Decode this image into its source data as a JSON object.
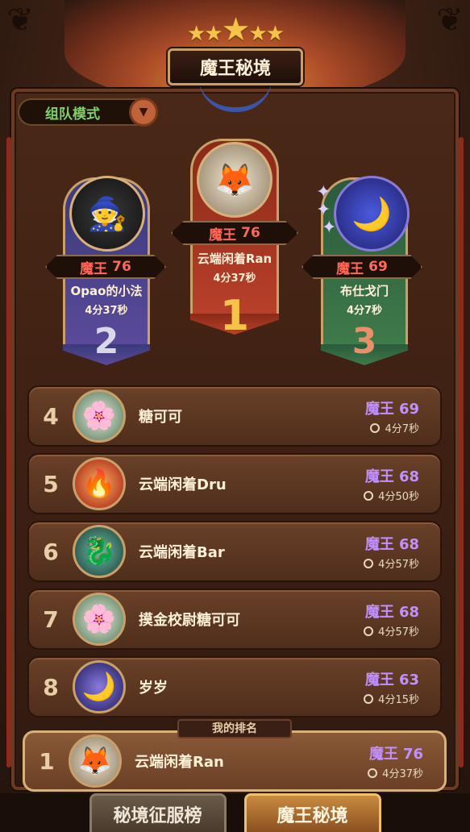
{
  "header": {
    "title": "魔王秘境",
    "stars": 5
  },
  "mode_selector": {
    "label": "组队模式"
  },
  "podium": [
    {
      "rank": "2",
      "level_label": "魔王",
      "level": "76",
      "name": "Opao的小法",
      "time": "4分37秒",
      "color": "#5a4a9a",
      "avatar_icon": "witch-hat-icon"
    },
    {
      "rank": "1",
      "level_label": "魔王",
      "level": "76",
      "name": "云端闲着Ran",
      "time": "4分37秒",
      "color": "#b8402a",
      "avatar_icon": "fox-hood-icon"
    },
    {
      "rank": "3",
      "level_label": "魔王",
      "level": "69",
      "name": "布仕戈门",
      "time": "4分7秒",
      "color": "#3f7a4a",
      "avatar_icon": "moon-orb-icon"
    }
  ],
  "list": [
    {
      "rank": "4",
      "name": "糖可可",
      "level_label": "魔王",
      "level": "69",
      "time": "4分7秒",
      "icon": "flower-spirit-icon"
    },
    {
      "rank": "5",
      "name": "云端闲着Dru",
      "level_label": "魔王",
      "level": "68",
      "time": "4分50秒",
      "icon": "fire-spiral-icon"
    },
    {
      "rank": "6",
      "name": "云端闲着Bar",
      "level_label": "魔王",
      "level": "68",
      "time": "4分57秒",
      "icon": "dragon-icon"
    },
    {
      "rank": "7",
      "name": "摸金校尉糖可可",
      "level_label": "魔王",
      "level": "68",
      "time": "4分57秒",
      "icon": "flower-spirit-icon"
    },
    {
      "rank": "8",
      "name": "岁岁",
      "level_label": "魔王",
      "level": "63",
      "time": "4分15秒",
      "icon": "winged-moon-icon"
    }
  ],
  "my_rank": {
    "tag": "我的排名",
    "rank": "1",
    "name": "云端闲着Ran",
    "level_label": "魔王",
    "level": "76",
    "time": "4分37秒",
    "icon": "fox-hood-icon"
  },
  "tabs": [
    {
      "label": "秘境征服榜",
      "active": false
    },
    {
      "label": "魔王秘境",
      "active": true
    }
  ]
}
